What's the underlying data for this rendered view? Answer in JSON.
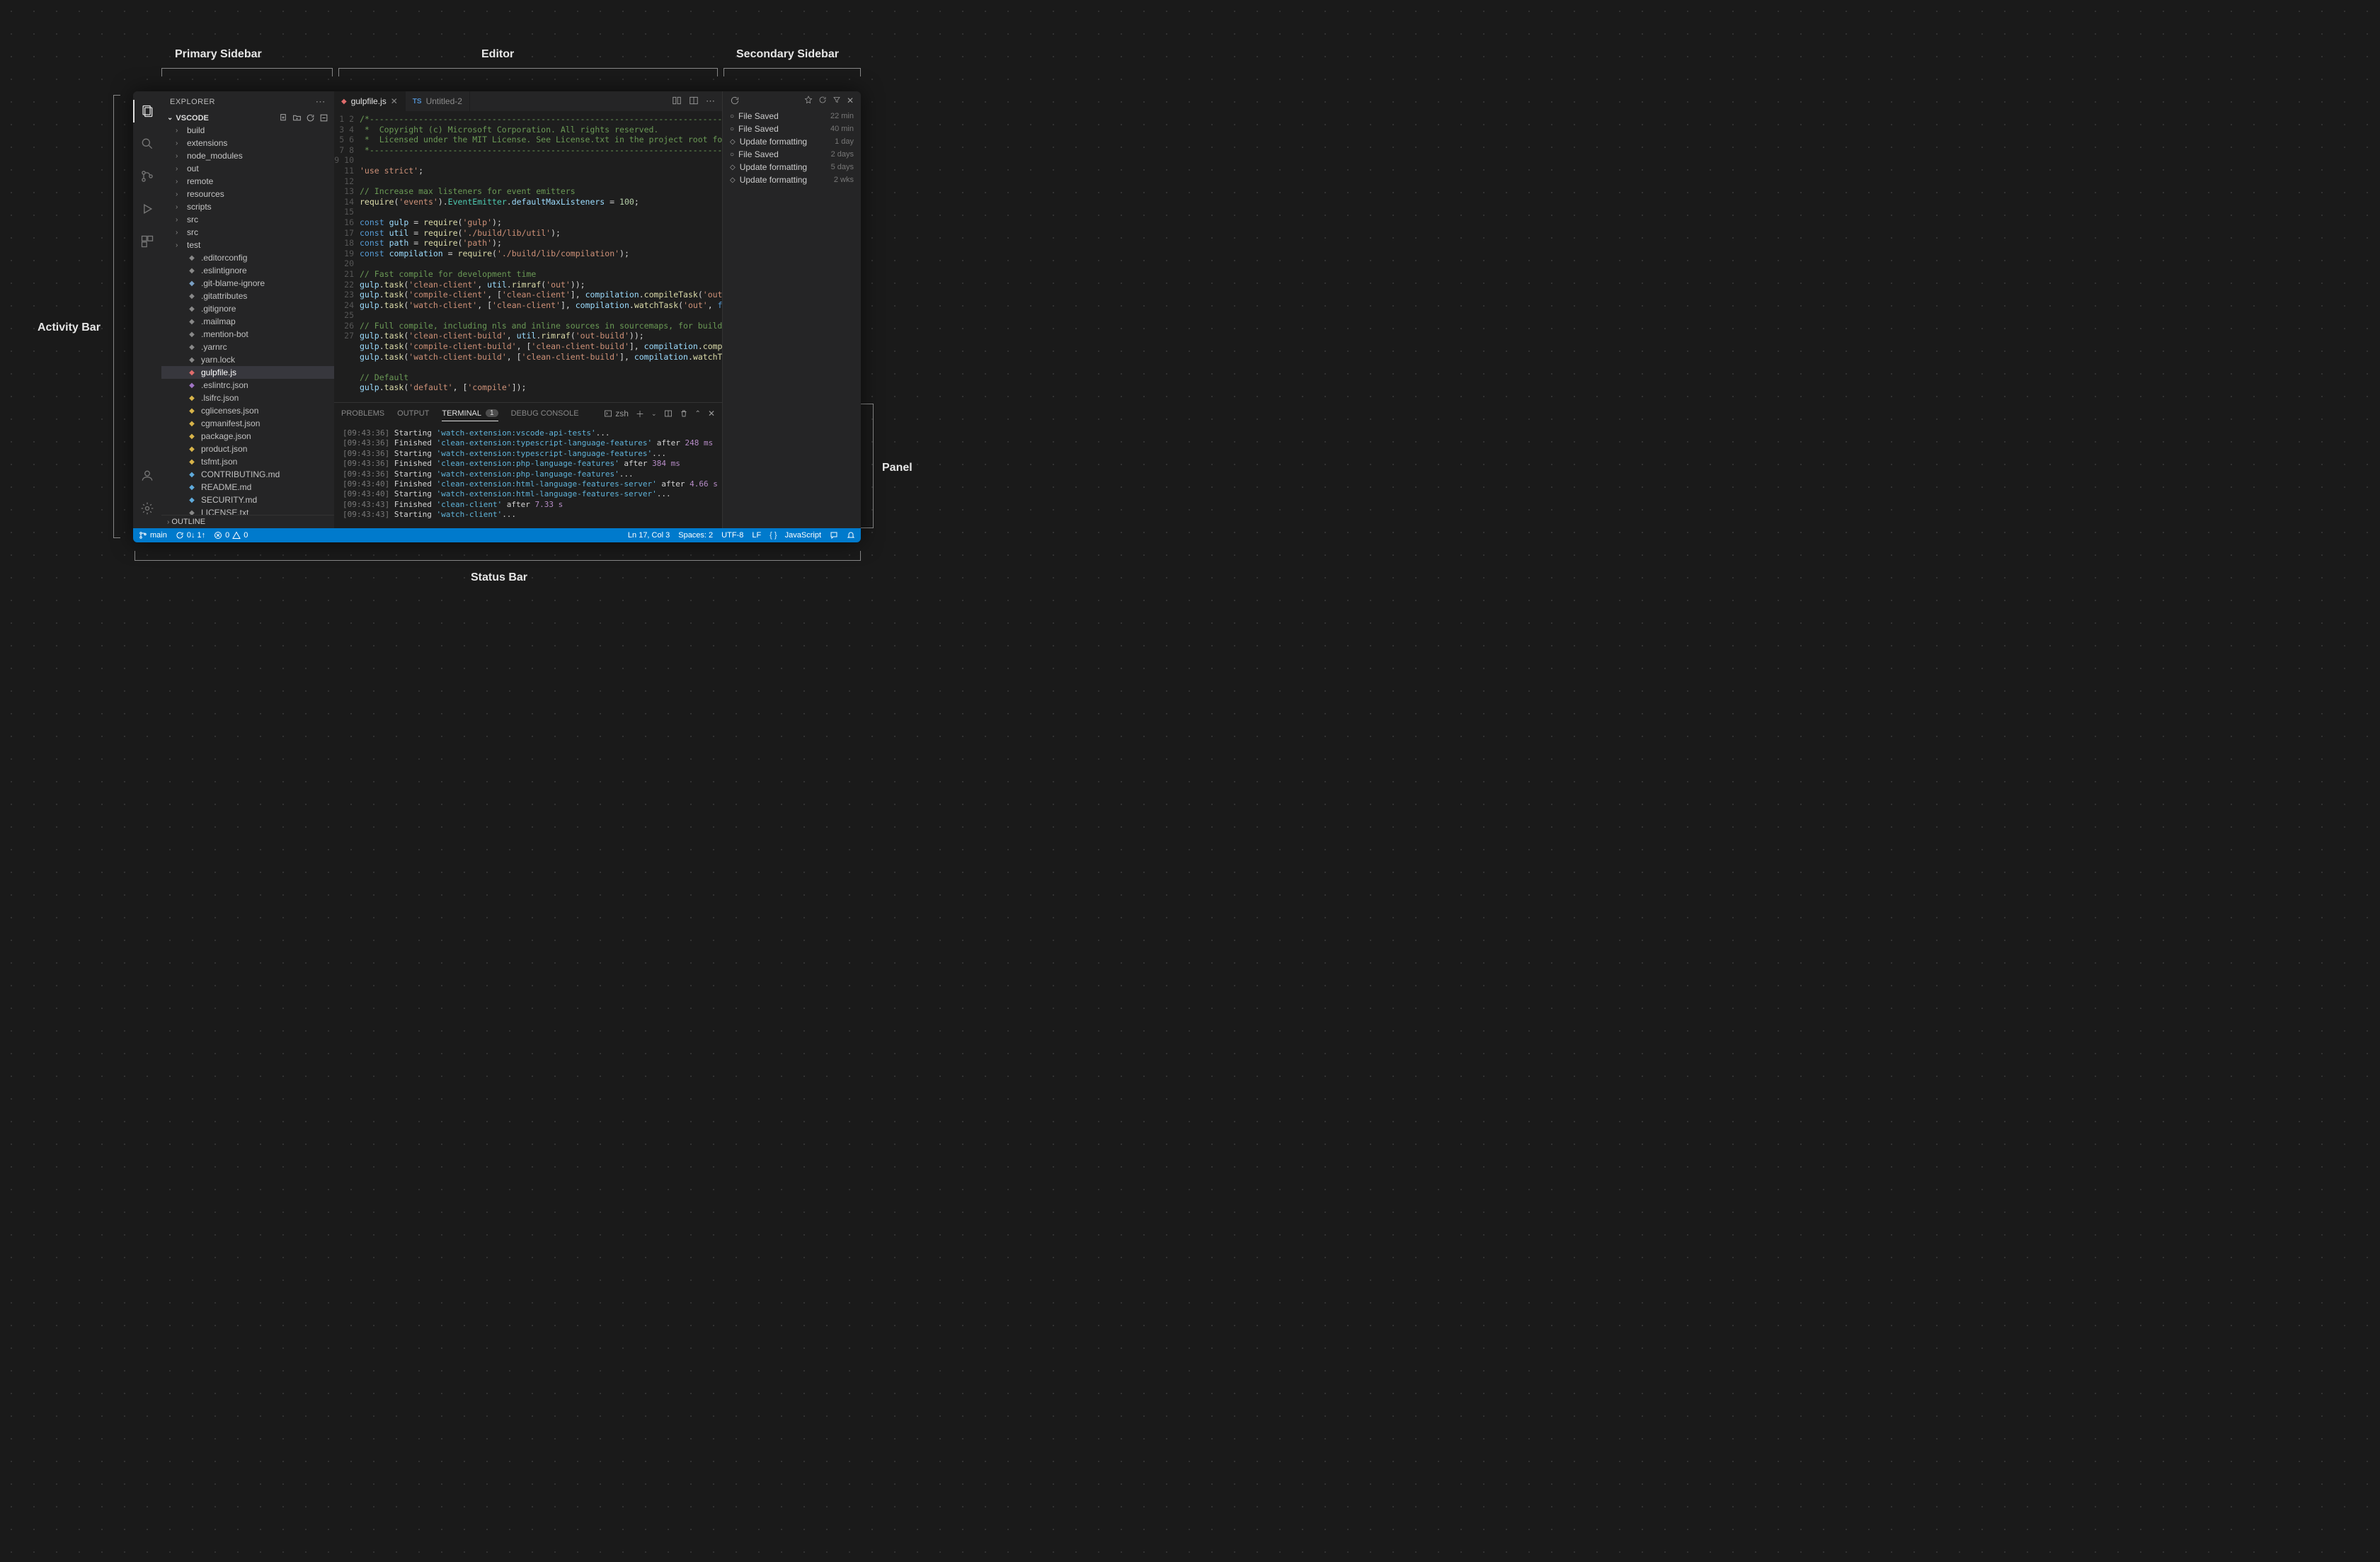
{
  "labels": {
    "activityBar": "Activity Bar",
    "primarySidebar": "Primary Sidebar",
    "editor": "Editor",
    "secondarySidebar": "Secondary Sidebar",
    "panel": "Panel",
    "statusBar": "Status Bar"
  },
  "sidebar": {
    "title": "EXPLORER",
    "section": "VSCODE",
    "outline": "OUTLINE",
    "folders": [
      "build",
      "extensions",
      "node_modules",
      "out",
      "remote",
      "resources",
      "scripts",
      "src",
      "src",
      "test"
    ],
    "files": [
      {
        "name": ".editorconfig",
        "color": "#888"
      },
      {
        "name": ".eslintignore",
        "color": "#888"
      },
      {
        "name": ".git-blame-ignore",
        "color": "#7aa0c4"
      },
      {
        "name": ".gitattributes",
        "color": "#888"
      },
      {
        "name": ".gitignore",
        "color": "#888"
      },
      {
        "name": ".mailmap",
        "color": "#888"
      },
      {
        "name": ".mention-bot",
        "color": "#888"
      },
      {
        "name": ".yarnrc",
        "color": "#888"
      },
      {
        "name": "yarn.lock",
        "color": "#888"
      },
      {
        "name": "gulpfile.js",
        "color": "#e06c6c",
        "active": true
      },
      {
        "name": ".eslintrc.json",
        "color": "#a074c4"
      },
      {
        "name": ".lsifrc.json",
        "color": "#d8b44a"
      },
      {
        "name": "cglicenses.json",
        "color": "#d8b44a"
      },
      {
        "name": "cgmanifest.json",
        "color": "#d8b44a"
      },
      {
        "name": "package.json",
        "color": "#d8b44a"
      },
      {
        "name": "product.json",
        "color": "#d8b44a"
      },
      {
        "name": "tsfmt.json",
        "color": "#d8b44a"
      },
      {
        "name": "CONTRIBUTING.md",
        "color": "#5faadb"
      },
      {
        "name": "README.md",
        "color": "#5faadb"
      },
      {
        "name": "SECURITY.md",
        "color": "#5faadb"
      },
      {
        "name": "LICENSE.txt",
        "color": "#888"
      }
    ]
  },
  "tabs": [
    {
      "name": "gulpfile.js",
      "iconColor": "#e06c6c",
      "active": true,
      "prefix": ""
    },
    {
      "name": "Untitled-2",
      "iconColor": "#4f8cc9",
      "active": false,
      "prefix": "TS"
    }
  ],
  "code": {
    "lines": 27
  },
  "panel": {
    "tabs": [
      "PROBLEMS",
      "OUTPUT",
      "TERMINAL",
      "DEBUG CONSOLE"
    ],
    "activeTab": "TERMINAL",
    "badge": "1",
    "shell": "zsh",
    "output": [
      {
        "time": "[09:43:36]",
        "action": "Starting",
        "task": "'watch-extension:vscode-api-tests'",
        "tail": "..."
      },
      {
        "time": "[09:43:36]",
        "action": "Finished",
        "task": "'clean-extension:typescript-language-features'",
        "tail": " after ",
        "dur": "248 ms"
      },
      {
        "time": "[09:43:36]",
        "action": "Starting",
        "task": "'watch-extension:typescript-language-features'",
        "tail": "..."
      },
      {
        "time": "[09:43:36]",
        "action": "Finished",
        "task": "'clean-extension:php-language-features'",
        "tail": " after ",
        "dur": "384 ms"
      },
      {
        "time": "[09:43:36]",
        "action": "Starting",
        "task": "'watch-extension:php-language-features'",
        "tail": "..."
      },
      {
        "time": "[09:43:40]",
        "action": "Finished",
        "task": "'clean-extension:html-language-features-server'",
        "tail": " after ",
        "dur": "4.66 s"
      },
      {
        "time": "[09:43:40]",
        "action": "Starting",
        "task": "'watch-extension:html-language-features-server'",
        "tail": "..."
      },
      {
        "time": "[09:43:43]",
        "action": "Finished",
        "task": "'clean-client'",
        "tail": " after ",
        "dur": "7.33 s"
      },
      {
        "time": "[09:43:43]",
        "action": "Starting",
        "task": "'watch-client'",
        "tail": "..."
      }
    ]
  },
  "timeline": [
    {
      "icon": "○",
      "label": "File Saved",
      "time": "22 min"
    },
    {
      "icon": "○",
      "label": "File Saved",
      "time": "40 min"
    },
    {
      "icon": "◇",
      "label": "Update formatting",
      "time": "1 day"
    },
    {
      "icon": "○",
      "label": "File Saved",
      "time": "2 days"
    },
    {
      "icon": "◇",
      "label": "Update formatting",
      "time": "5 days"
    },
    {
      "icon": "◇",
      "label": "Update formatting",
      "time": "2 wks"
    }
  ],
  "statusbar": {
    "branch": "main",
    "sync": "0↓ 1↑",
    "errors": "0",
    "warnings": "0",
    "lncol": "Ln 17, Col 3",
    "spaces": "Spaces: 2",
    "encoding": "UTF-8",
    "eol": "LF",
    "lang": "JavaScript"
  }
}
